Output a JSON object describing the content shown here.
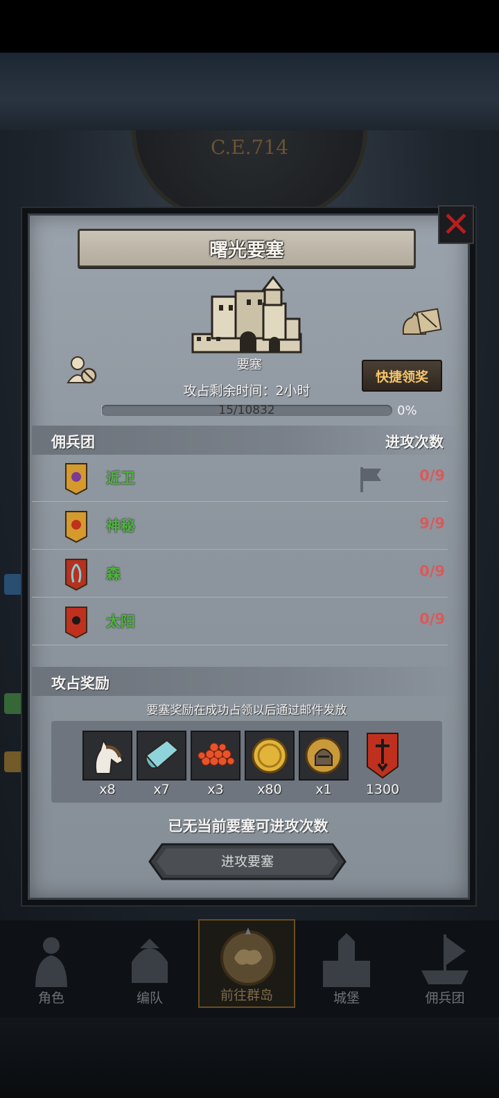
{
  "header": {
    "era": "C.E.714"
  },
  "panel": {
    "title": "曙光要塞",
    "building_label": "要塞",
    "quick_claim_label": "快捷领奖",
    "time_remaining": "攻占剩余时间：2小时",
    "progress": {
      "text": "15/10832",
      "percent_label": "0%",
      "fraction": 0.0014
    },
    "mercenary_section": {
      "title": "佣兵团",
      "column_label": "进攻次数"
    },
    "mercenaries": [
      {
        "name": "近卫",
        "count": "0/9",
        "banner": "sun-banner-gold"
      },
      {
        "name": "神秘",
        "count": "9/9",
        "banner": "sun-banner-gold-red"
      },
      {
        "name": "森",
        "count": "0/9",
        "banner": "tree-banner-red"
      },
      {
        "name": "太阳",
        "count": "0/9",
        "banner": "sun-banner-red"
      }
    ],
    "rewards_section": {
      "title": "攻占奖励",
      "note": "要塞奖励在成功占领以后通过邮件发放"
    },
    "rewards": [
      {
        "icon": "horse-icon",
        "count": "x8"
      },
      {
        "icon": "cloth-icon",
        "count": "x7"
      },
      {
        "icon": "red-beads-icon",
        "count": "x3"
      },
      {
        "icon": "gold-coin-icon",
        "count": "x80"
      },
      {
        "icon": "helmet-icon",
        "count": "x1"
      },
      {
        "icon": "guild-banner-icon",
        "count": "1300"
      }
    ],
    "no_attacks_text": "已无当前要塞可进攻次数",
    "attack_button_label": "进攻要塞"
  },
  "nav": [
    {
      "label": "角色",
      "icon": "knight-icon",
      "active": false
    },
    {
      "label": "编队",
      "icon": "helmet-icon",
      "active": false
    },
    {
      "label": "前往群岛",
      "icon": "compass-map-icon",
      "active": true
    },
    {
      "label": "城堡",
      "icon": "castle-icon",
      "active": false
    },
    {
      "label": "佣兵团",
      "icon": "ship-icon",
      "active": false
    }
  ],
  "colors": {
    "name_green": "#4fb33e",
    "count_red": "#d95a5a",
    "quick_claim_text": "#f4c56a",
    "close_x": "#b81e1e"
  }
}
